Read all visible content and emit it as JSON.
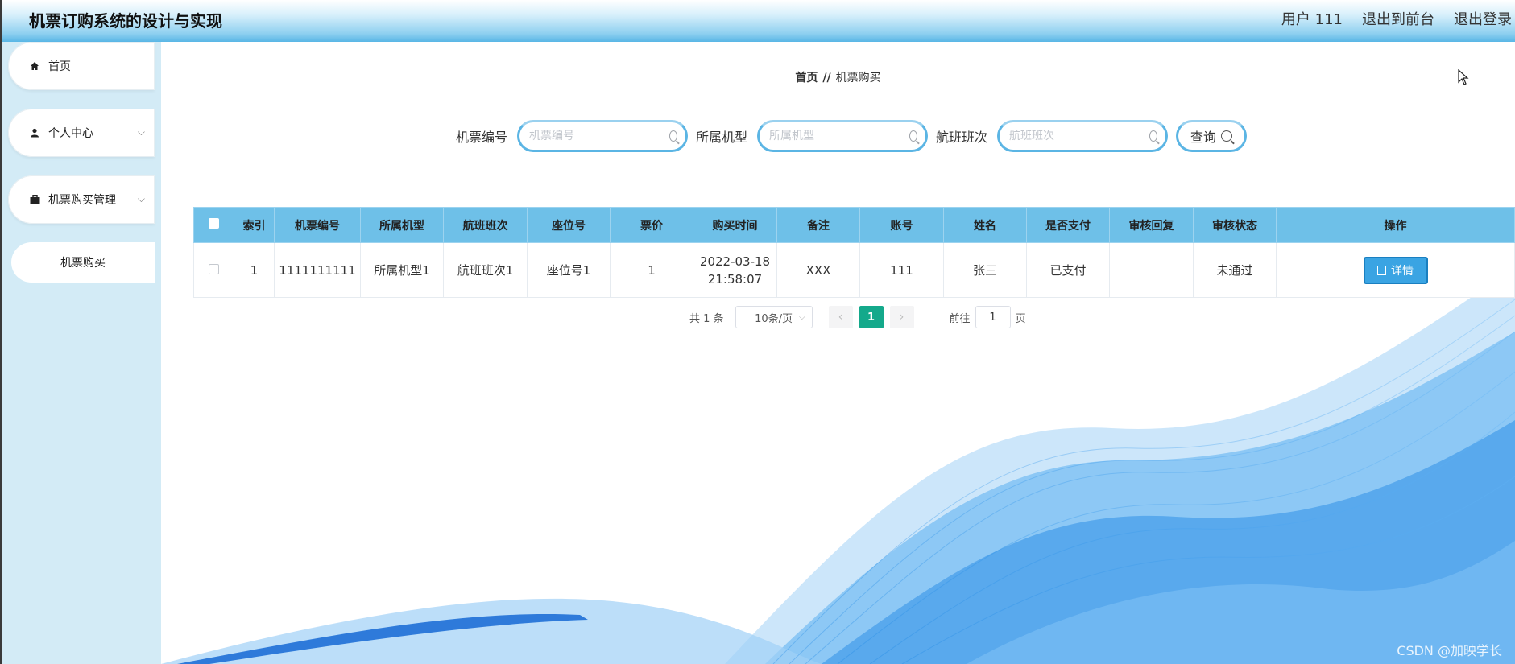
{
  "header": {
    "title": "机票订购系统的设计与实现",
    "user_label": "用户 111",
    "back_label": "退出到前台",
    "logout_label": "退出登录"
  },
  "sidebar": {
    "items": [
      {
        "label": "首页",
        "icon": "home-icon"
      },
      {
        "label": "个人中心",
        "icon": "user-icon"
      },
      {
        "label": "机票购买管理",
        "icon": "briefcase-icon"
      }
    ],
    "sub_items": [
      {
        "label": "机票购买"
      }
    ]
  },
  "breadcrumb": {
    "home": "首页",
    "separator": "//",
    "current": "机票购买"
  },
  "search": {
    "fields": [
      {
        "label": "机票编号",
        "placeholder": "机票编号",
        "value": ""
      },
      {
        "label": "所属机型",
        "placeholder": "所属机型",
        "value": ""
      },
      {
        "label": "航班班次",
        "placeholder": "航班班次",
        "value": ""
      }
    ],
    "button_label": "查询"
  },
  "table": {
    "columns": [
      "索引",
      "机票编号",
      "所属机型",
      "航班班次",
      "座位号",
      "票价",
      "购买时间",
      "备注",
      "账号",
      "姓名",
      "是否支付",
      "审核回复",
      "审核状态",
      "操作"
    ],
    "rows": [
      {
        "index": "1",
        "ticket_no": "1111111111",
        "model": "所属机型1",
        "flight": "航班班次1",
        "seat": "座位号1",
        "price": "1",
        "time_date": "2022-03-18",
        "time_clock": "21:58:07",
        "remark": "XXX",
        "account": "111",
        "name": "张三",
        "paid": "已支付",
        "reply": "",
        "status": "未通过",
        "action_label": "详情"
      }
    ]
  },
  "pagination": {
    "total": "共 1 条",
    "page_size": "10条/页",
    "current_page": "1",
    "goto_label": "前往",
    "goto_value": "1",
    "page_suffix": "页"
  },
  "watermark": "CSDN @加映学长",
  "colors": {
    "header_blue": "#59b6e6",
    "sidebar_bg": "#d3ebf6",
    "table_header": "#6ec0e8",
    "detail_button": "#3aa4e3",
    "active_page": "#14a98b"
  }
}
